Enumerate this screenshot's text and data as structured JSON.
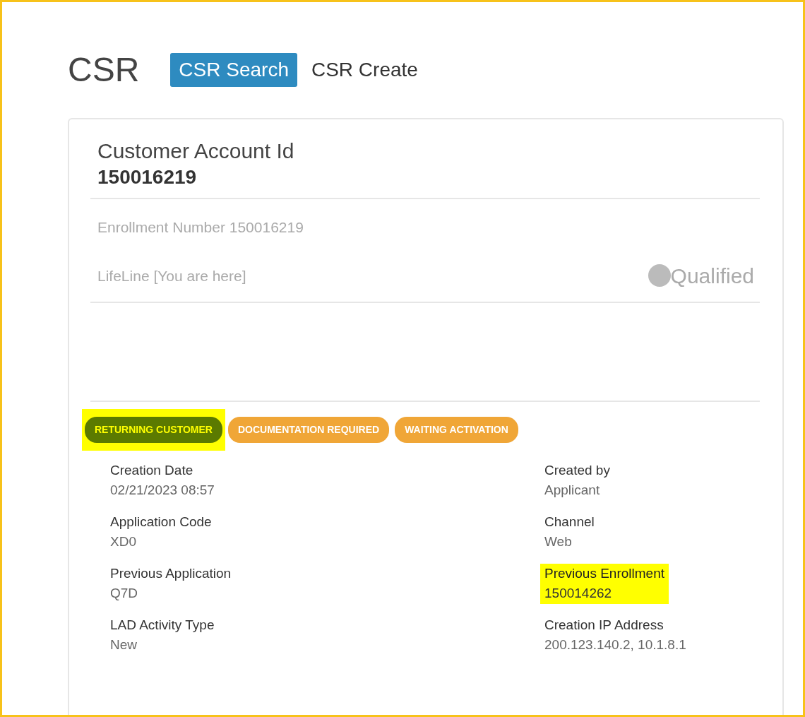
{
  "header": {
    "title": "CSR",
    "tabs": [
      {
        "label": "CSR Search",
        "selected": true
      },
      {
        "label": "CSR Create",
        "selected": false
      }
    ]
  },
  "account": {
    "label": "Customer Account Id",
    "id": "150016219",
    "enrollment": "Enrollment Number 150016219",
    "program": "LifeLine [You are here]",
    "status": "Qualified"
  },
  "tags": [
    {
      "label": "RETURNING CUSTOMER",
      "color": "#5b7a00",
      "highlighted": true
    },
    {
      "label": "DOCUMENTATION REQUIRED",
      "color": "#f0a637",
      "highlighted": false
    },
    {
      "label": "WAITING ACTIVATION",
      "color": "#f0a637",
      "highlighted": false
    }
  ],
  "fields": [
    {
      "label": "Creation Date",
      "value": "02/21/2023 08:57",
      "highlighted": false
    },
    {
      "label": "Created by",
      "value": "Applicant",
      "highlighted": false
    },
    {
      "label": "Application Code",
      "value": "XD0",
      "highlighted": false
    },
    {
      "label": "Channel",
      "value": "Web",
      "highlighted": false
    },
    {
      "label": "Previous Application",
      "value": "Q7D",
      "highlighted": false
    },
    {
      "label": "Previous Enrollment",
      "value": "150014262",
      "highlighted": true
    },
    {
      "label": "LAD Activity Type",
      "value": "New",
      "highlighted": false
    },
    {
      "label": "Creation IP Address",
      "value": "200.123.140.2, 10.1.8.1",
      "highlighted": false
    }
  ]
}
